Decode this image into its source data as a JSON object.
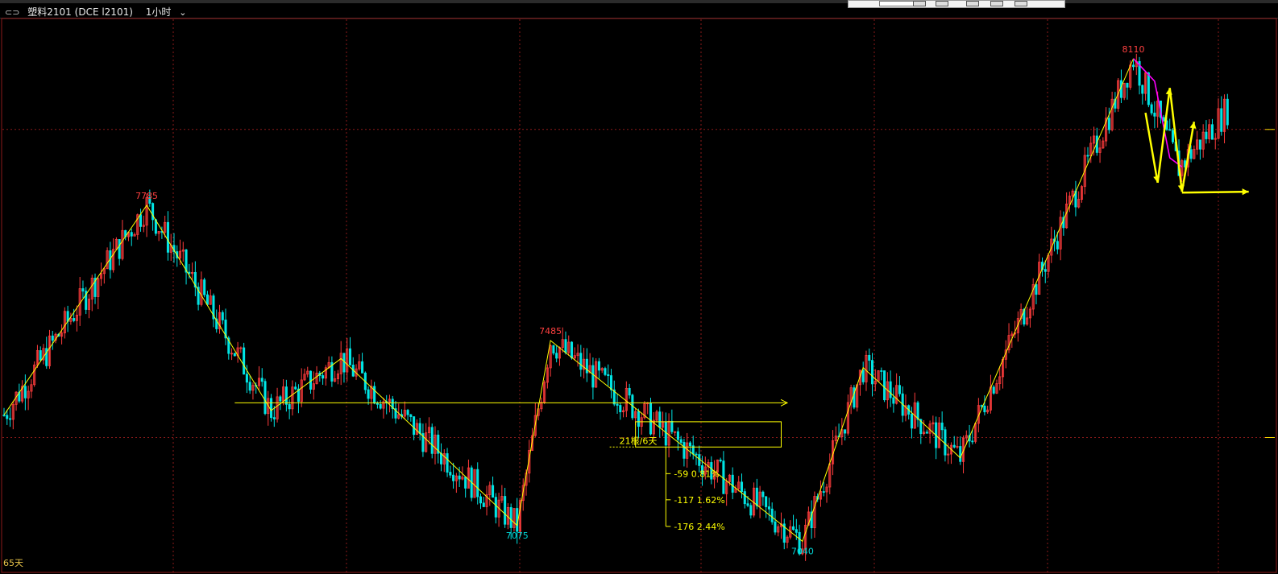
{
  "header": {
    "link_icon": "⊂⊃",
    "symbol": "塑料2101",
    "contract": "(DCE l2101)",
    "period": "1小时",
    "chevron": "⌄"
  },
  "chart_data": {
    "type": "candlestick",
    "title": "塑料2101(DCE l2101) 1小时",
    "span_label": "65天",
    "colors": {
      "up": "#ff3c3c",
      "down": "#00e5e5",
      "zigzag": "#ffff00",
      "grid": "#8c1a1a",
      "peak_label": "#ff4040",
      "trough_label": "#00d8d8",
      "accent": "#ff00ff"
    },
    "ylim": [
      6980,
      8190
    ],
    "zigzag_points": [
      {
        "bar": 0,
        "price": 7320,
        "label": ""
      },
      {
        "bar": 47,
        "price": 7785,
        "label": "7785"
      },
      {
        "bar": 88,
        "price": 7330,
        "label": ""
      },
      {
        "bar": 111,
        "price": 7445,
        "label": ""
      },
      {
        "bar": 169,
        "price": 7075,
        "label": "7075"
      },
      {
        "bar": 180,
        "price": 7485,
        "label": "7485"
      },
      {
        "bar": 263,
        "price": 7040,
        "label": "7040"
      },
      {
        "bar": 283,
        "price": 7425,
        "label": ""
      },
      {
        "bar": 315,
        "price": 7225,
        "label": ""
      },
      {
        "bar": 372,
        "price": 8110,
        "label": "8110"
      },
      {
        "bar": 387,
        "price": 7870,
        "label": ""
      }
    ],
    "horizontal_line": {
      "price": 7347,
      "from_bar": 76,
      "to_bar": 258
    },
    "box": {
      "from_bar": 208,
      "to_bar": 256,
      "top": 7305,
      "bottom": 7249,
      "label": "21根/6天"
    },
    "measure": {
      "from_bar": 218,
      "base_price": 7249,
      "levels": [
        {
          "diff": "-59",
          "pct": "0.81%"
        },
        {
          "diff": "-117",
          "pct": "1.62%"
        },
        {
          "diff": "-176",
          "pct": "2.44%"
        }
      ]
    },
    "right_ticks": [
      7953,
      7270
    ]
  }
}
